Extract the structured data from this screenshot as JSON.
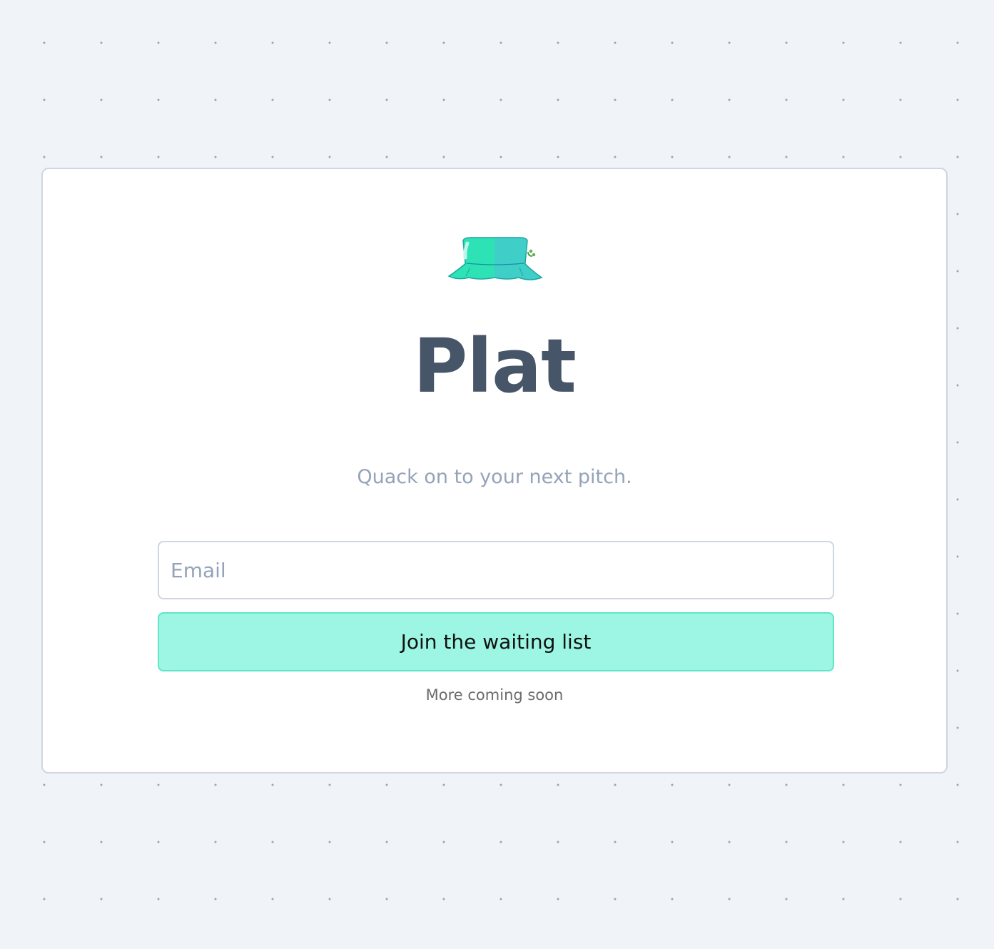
{
  "app": {
    "title": "Plat",
    "tagline": "Quack on to your next pitch.",
    "logo_icon": "bucket-hat-icon"
  },
  "signup": {
    "email_placeholder": "Email",
    "email_value": "",
    "submit_label": "Join the waiting list",
    "footnote": "More coming soon"
  },
  "colors": {
    "page_background": "#f0f3f8",
    "title": "#475569",
    "tagline": "#94a3b8",
    "button_background": "#9cf6e3",
    "button_border": "#5fe6c7",
    "hat_main": "#2de3b5",
    "hat_shade": "#40cfc8"
  }
}
